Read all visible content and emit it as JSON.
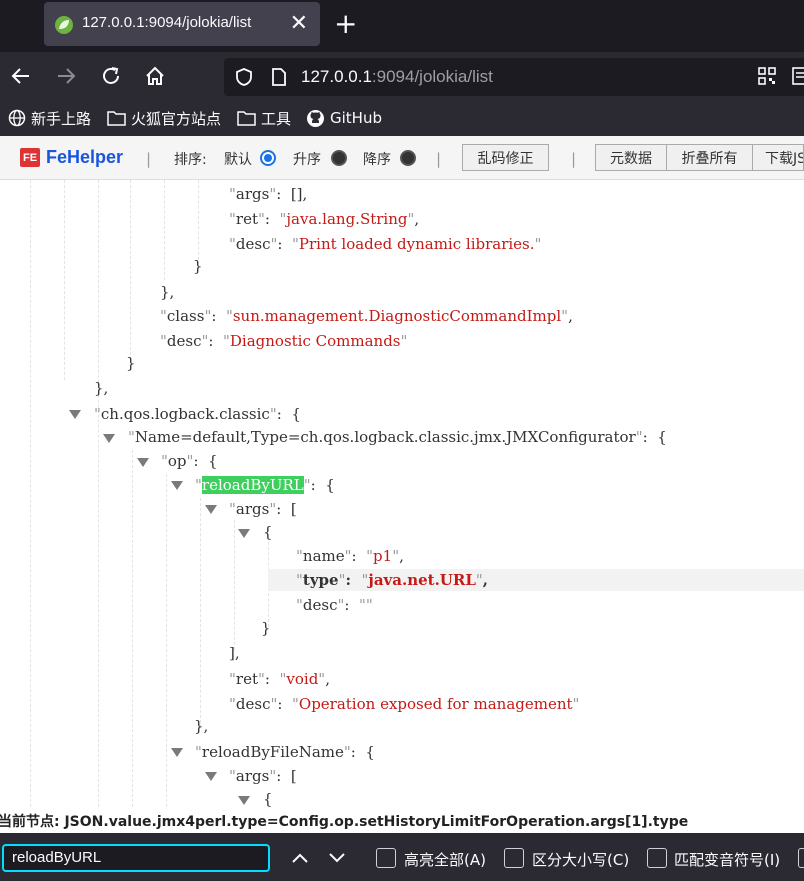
{
  "tab": {
    "title": "127.0.0.1:9094/jolokia/list",
    "close": "✕",
    "new_tab": "+"
  },
  "url": {
    "host": "127.0.0.1",
    "rest": ":9094/jolokia/list"
  },
  "bookmarks": [
    {
      "label": "新手上路",
      "icon": "globe-icon"
    },
    {
      "label": "火狐官方站点",
      "icon": "folder-icon"
    },
    {
      "label": "工具",
      "icon": "folder-icon"
    },
    {
      "label": "GitHub",
      "icon": "github-icon"
    }
  ],
  "fehelper": {
    "logo": "FE",
    "name": "FeHelper",
    "sort_label": "排序:",
    "sort_default": "默认",
    "sort_asc": "升序",
    "sort_desc": "降序",
    "fix_encoding": "乱码修正",
    "metadata": "元数据",
    "fold_all": "折叠所有",
    "download": "下载JSON",
    "sep": "|"
  },
  "json_lines": {
    "l1": {
      "key": "args",
      "val": "[],"
    },
    "l2": {
      "key": "ret",
      "val": "java.lang.String"
    },
    "l3": {
      "key": "desc",
      "val": "Print loaded dynamic libraries."
    },
    "l4": "}",
    "l5": "},",
    "l6": {
      "key": "class",
      "val": "sun.management.DiagnosticCommandImpl"
    },
    "l7": {
      "key": "desc",
      "val": "Diagnostic Commands"
    },
    "l8": "}",
    "l9": "},",
    "l10": {
      "key": "ch.qos.logback.classic",
      "val": "{"
    },
    "l11": {
      "key": "Name=default,Type=ch.qos.logback.classic.jmx.JMXConfigurator",
      "val": "{"
    },
    "l12": {
      "key": "op",
      "val": "{"
    },
    "l13": {
      "key": "reloadByURL",
      "val": "{"
    },
    "l14": {
      "key": "args",
      "val": "["
    },
    "l15": "{",
    "l16": {
      "key": "name",
      "val": "p1"
    },
    "l17": {
      "key": "type",
      "val": "java.net.URL"
    },
    "l18": {
      "key": "desc",
      "val": ""
    },
    "l19": "}",
    "l20": "],",
    "l21": {
      "key": "ret",
      "val": "void"
    },
    "l22": {
      "key": "desc",
      "val": "Operation exposed for management"
    },
    "l23": "},",
    "l24": {
      "key": "reloadByFileName",
      "val": "{"
    },
    "l25": {
      "key": "args",
      "val": "["
    },
    "l26": "{"
  },
  "status": "当前节点: JSON.value.jmx4perl.type=Config.op.setHistoryLimitForOperation.args[1].type",
  "find": {
    "query": "reloadByURL",
    "highlight_all": "高亮全部(A)",
    "match_case": "区分大小写(C)",
    "match_diacritics": "匹配变音符号(I)"
  }
}
